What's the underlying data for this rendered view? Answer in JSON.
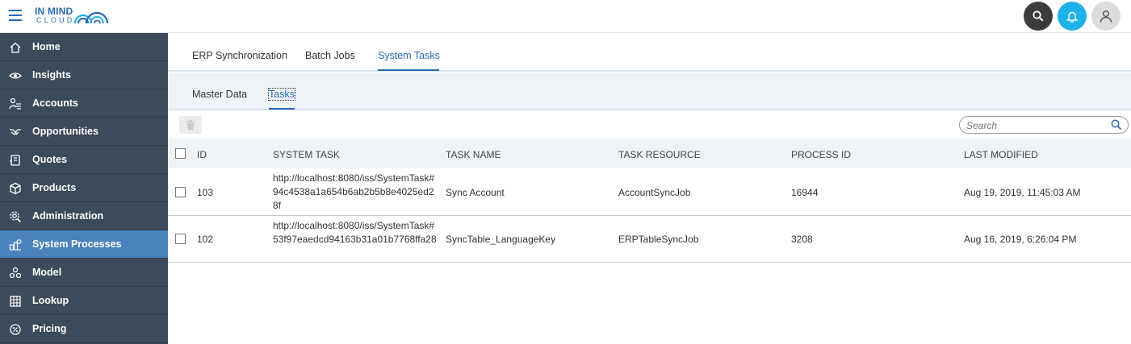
{
  "brand": {
    "logo_line1": "IN MIND",
    "logo_line2": "CLOUD",
    "primary_color": "#2a6ab4",
    "sidebar_color": "#3c4a5c",
    "active_color": "#4a83bd"
  },
  "header": {
    "icons": [
      "menu-icon",
      "search-icon",
      "bell-icon",
      "user-icon"
    ]
  },
  "sidebar": {
    "items": [
      {
        "label": "Home",
        "icon": "home-icon"
      },
      {
        "label": "Insights",
        "icon": "eye-icon"
      },
      {
        "label": "Accounts",
        "icon": "accounts-icon"
      },
      {
        "label": "Opportunities",
        "icon": "handshake-icon"
      },
      {
        "label": "Quotes",
        "icon": "quotes-icon"
      },
      {
        "label": "Products",
        "icon": "box-icon"
      },
      {
        "label": "Administration",
        "icon": "admin-gear-icon"
      },
      {
        "label": "System Processes",
        "icon": "processes-icon",
        "active": true
      },
      {
        "label": "Model",
        "icon": "model-icon"
      },
      {
        "label": "Lookup",
        "icon": "grid-icon"
      },
      {
        "label": "Pricing",
        "icon": "pricing-icon"
      }
    ]
  },
  "tabs": {
    "items": [
      "ERP Synchronization",
      "Batch Jobs",
      "System Tasks"
    ],
    "active": "System Tasks"
  },
  "subtabs": {
    "items": [
      "Master Data",
      "Tasks"
    ],
    "active": "Tasks"
  },
  "toolbar": {
    "delete_icon": "trash-icon",
    "search_placeholder": "Search",
    "search_value": ""
  },
  "table": {
    "columns": [
      "ID",
      "SYSTEM TASK",
      "TASK NAME",
      "TASK RESOURCE",
      "PROCESS ID",
      "LAST MODIFIED"
    ],
    "rows": [
      {
        "id": "103",
        "system_task": "http://localhost:8080/iss/SystemTask#94c4538a1a654b6ab2b5b8e4025ed28f",
        "task_name": "Sync Account",
        "task_resource": "AccountSyncJob",
        "process_id": "16944",
        "last_modified": "Aug 19, 2019, 11:45:03 AM"
      },
      {
        "id": "102",
        "system_task": "http://localhost:8080/iss/SystemTask#53f97eaedcd94163b31a01b7768ffa28",
        "task_name": "SyncTable_LanguageKey",
        "task_resource": "ERPTableSyncJob",
        "process_id": "3208",
        "last_modified": "Aug 16, 2019, 6:26:04 PM"
      }
    ]
  }
}
